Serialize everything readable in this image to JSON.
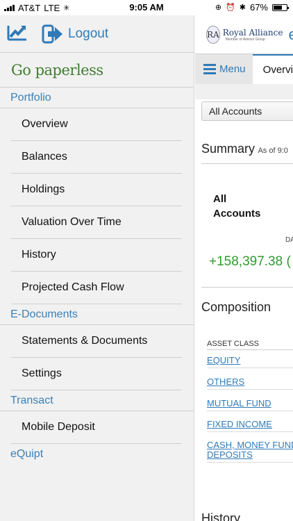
{
  "status_bar": {
    "carrier": "AT&T",
    "network": "LTE",
    "time": "9:05 AM",
    "battery": "67%",
    "battery_level": 0.67
  },
  "sidebar": {
    "logout_label": "Logout",
    "go_paperless": "Go paperless",
    "sections": {
      "portfolio": "Portfolio",
      "e_documents": "E-Documents",
      "transact": "Transact",
      "equipt": "eQuipt"
    },
    "portfolio_items": [
      "Overview",
      "Balances",
      "Holdings",
      "Valuation Over Time",
      "History",
      "Projected Cash Flow"
    ],
    "edoc_items": [
      "Statements & Documents",
      "Settings"
    ],
    "transact_items": [
      "Mobile Deposit"
    ]
  },
  "main": {
    "brand": {
      "seal": "RA",
      "name": "Royal Alliance",
      "sub": "Member of Advisor Group",
      "e": "e"
    },
    "menu_label": "Menu",
    "active_tab": "Overvi",
    "account_select": "All Accounts",
    "summary_title": "Summary",
    "summary_asof": "As of 9:0",
    "all_accounts_line1": "All",
    "all_accounts_line2": "Accounts",
    "da_label": "DA",
    "gain_value": "+158,397.38 (",
    "composition_title": "Composition",
    "asset_class_header": "ASSET CLASS",
    "asset_classes": [
      "EQUITY",
      "OTHERS",
      "MUTUAL FUND",
      "FIXED INCOME",
      "CASH, MONEY FUND",
      "DEPOSITS"
    ],
    "history_title": "History"
  },
  "colors": {
    "link_blue": "#2f7ab8",
    "paperless_green": "#3f7e2e",
    "gain_green": "#2e9a2e"
  }
}
